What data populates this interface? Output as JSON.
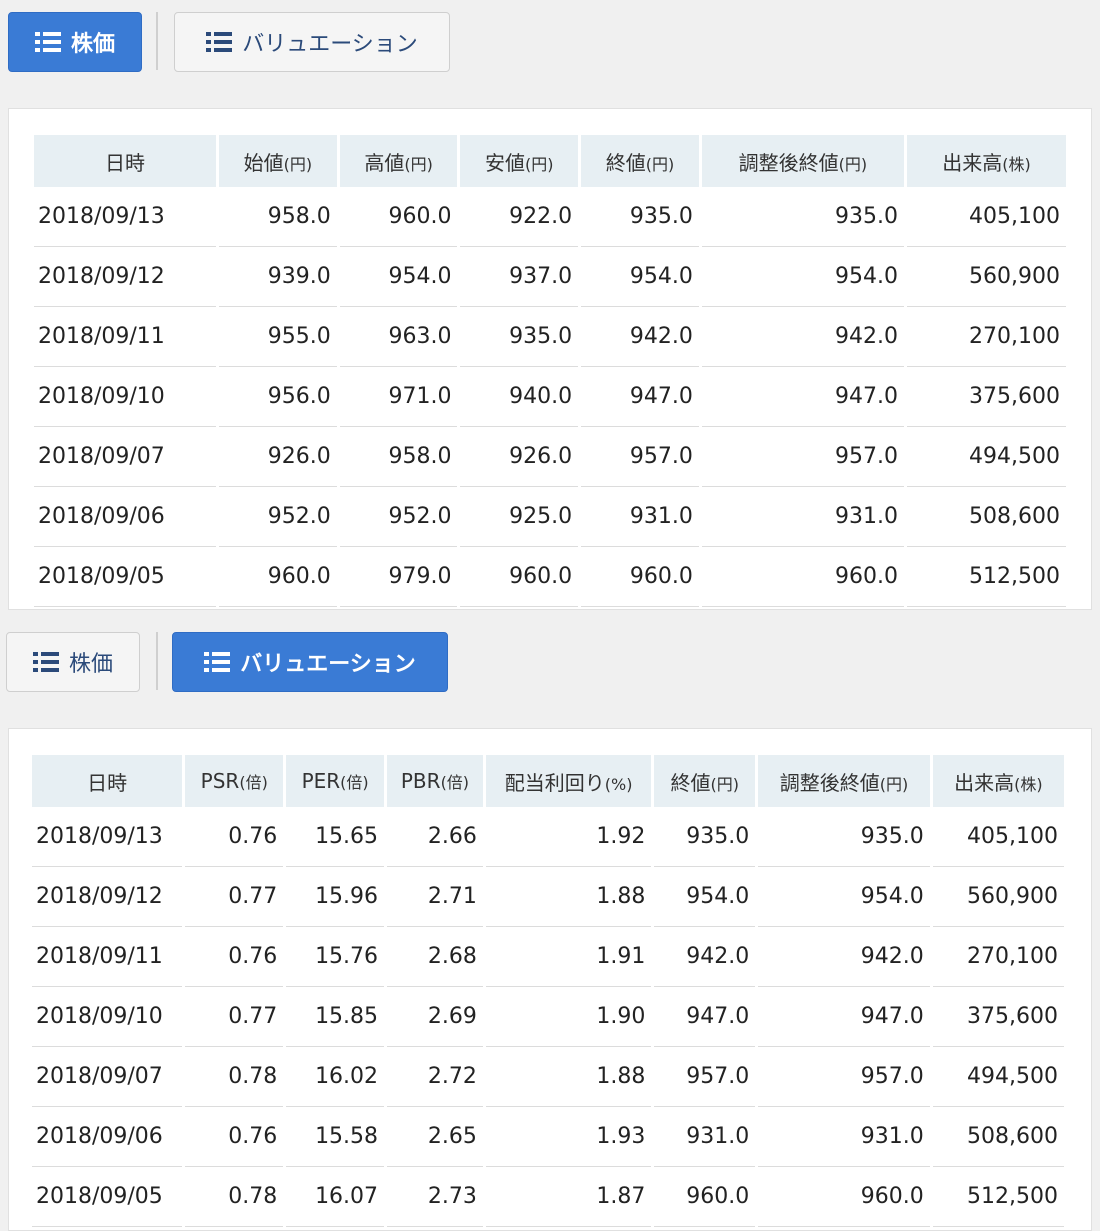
{
  "tabs": {
    "stock": "株価",
    "valuation": "バリュエーション"
  },
  "price_table": {
    "headers": [
      {
        "label": "日時",
        "unit": ""
      },
      {
        "label": "始値",
        "unit": "(円)"
      },
      {
        "label": "高値",
        "unit": "(円)"
      },
      {
        "label": "安値",
        "unit": "(円)"
      },
      {
        "label": "終値",
        "unit": "(円)"
      },
      {
        "label": "調整後終値",
        "unit": "(円)"
      },
      {
        "label": "出来高",
        "unit": "(株)"
      }
    ],
    "rows": [
      [
        "2018/09/13",
        "958.0",
        "960.0",
        "922.0",
        "935.0",
        "935.0",
        "405,100"
      ],
      [
        "2018/09/12",
        "939.0",
        "954.0",
        "937.0",
        "954.0",
        "954.0",
        "560,900"
      ],
      [
        "2018/09/11",
        "955.0",
        "963.0",
        "935.0",
        "942.0",
        "942.0",
        "270,100"
      ],
      [
        "2018/09/10",
        "956.0",
        "971.0",
        "940.0",
        "947.0",
        "947.0",
        "375,600"
      ],
      [
        "2018/09/07",
        "926.0",
        "958.0",
        "926.0",
        "957.0",
        "957.0",
        "494,500"
      ],
      [
        "2018/09/06",
        "952.0",
        "952.0",
        "925.0",
        "931.0",
        "931.0",
        "508,600"
      ],
      [
        "2018/09/05",
        "960.0",
        "979.0",
        "960.0",
        "960.0",
        "960.0",
        "512,500"
      ]
    ]
  },
  "valuation_table": {
    "headers": [
      {
        "label": "日時",
        "unit": ""
      },
      {
        "label": "PSR",
        "unit": "(倍)"
      },
      {
        "label": "PER",
        "unit": "(倍)"
      },
      {
        "label": "PBR",
        "unit": "(倍)"
      },
      {
        "label": "配当利回り",
        "unit": "(%)"
      },
      {
        "label": "終値",
        "unit": "(円)"
      },
      {
        "label": "調整後終値",
        "unit": "(円)"
      },
      {
        "label": "出来高",
        "unit": "(株)"
      }
    ],
    "rows": [
      [
        "2018/09/13",
        "0.76",
        "15.65",
        "2.66",
        "1.92",
        "935.0",
        "935.0",
        "405,100"
      ],
      [
        "2018/09/12",
        "0.77",
        "15.96",
        "2.71",
        "1.88",
        "954.0",
        "954.0",
        "560,900"
      ],
      [
        "2018/09/11",
        "0.76",
        "15.76",
        "2.68",
        "1.91",
        "942.0",
        "942.0",
        "270,100"
      ],
      [
        "2018/09/10",
        "0.77",
        "15.85",
        "2.69",
        "1.90",
        "947.0",
        "947.0",
        "375,600"
      ],
      [
        "2018/09/07",
        "0.78",
        "16.02",
        "2.72",
        "1.88",
        "957.0",
        "957.0",
        "494,500"
      ],
      [
        "2018/09/06",
        "0.76",
        "15.58",
        "2.65",
        "1.93",
        "931.0",
        "931.0",
        "508,600"
      ],
      [
        "2018/09/05",
        "0.78",
        "16.07",
        "2.73",
        "1.87",
        "960.0",
        "960.0",
        "512,500"
      ]
    ]
  },
  "icons": {
    "tab_icon": "list-icon"
  },
  "colors": {
    "accent": "#3a7bd5",
    "header_bg": "#e7eff3",
    "inactive_text": "#2b4a7a"
  }
}
